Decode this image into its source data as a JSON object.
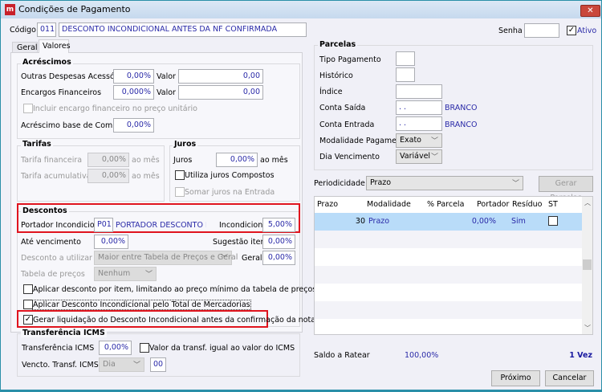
{
  "window": {
    "title": "Condições de Pagamento",
    "close_icon": "close-icon"
  },
  "header": {
    "codigo_label": "Código",
    "codigo": "011",
    "descricao": "DESCONTO INCONDICIONAL ANTES DA NF CONFIRMADA",
    "senha_label": "Senha",
    "senha": "",
    "ativo_label": "Ativo",
    "ativo_checked": true
  },
  "tabs": [
    {
      "label": "Geral",
      "active": false
    },
    {
      "label": "Valores",
      "active": true
    }
  ],
  "acrescimos": {
    "title": "Acréscimos",
    "outras_label": "Outras Despesas Acessórias",
    "outras_pct": "0,00%",
    "valor_label": "Valor",
    "outras_valor": "0,00",
    "encargos_label": "Encargos Financeiros",
    "encargos_pct": "0,000%",
    "encargos_valor": "0,00",
    "incluir_label": "Incluir encargo financeiro no preço unitário",
    "comissao_label": "Acréscimo base de Comissão",
    "comissao_pct": "0,00%"
  },
  "tarifas": {
    "title": "Tarifas",
    "financeira_label": "Tarifa financeira",
    "financeira": "0,00%",
    "acumulativa_label": "Tarifa acumulativa",
    "acumulativa": "0,00%",
    "ao_mes": "ao mês"
  },
  "juros": {
    "title": "Juros",
    "juros_label": "Juros",
    "juros": "0,00%",
    "ao_mes": "ao mês",
    "compostos_label": "Utiliza juros Compostos",
    "somar_label": "Somar juros na Entrada"
  },
  "descontos": {
    "title": "Descontos",
    "portador_label": "Portador Incondicional",
    "portador_code": "P01",
    "portador_name": "PORTADOR DESCONTO INCONDICIONAL",
    "incondicional_label": "Incondicional",
    "incondicional": "5,00%",
    "ate_label": "Até vencimento",
    "ate": "0,00%",
    "sugestao_label": "Sugestão itens",
    "sugestao": "0,00%",
    "utilizar_label": "Desconto a utilizar",
    "utilizar": "Maior entre Tabela de Preços e Geral",
    "geral_label": "Geral",
    "geral": "0,00%",
    "tabela_label": "Tabela de preços",
    "tabela": "Nenhum",
    "cb1": "Aplicar desconto por item, limitando ao preço mínimo da tabela de preços",
    "cb2": "Aplicar Desconto Incondicional pelo Total de Mercadorias",
    "cb3": "Gerar liquidação do Desconto Incondicional antes da confirmação da nota",
    "cb3_checked": true
  },
  "icms": {
    "title": "Transferência ICMS",
    "transf_label": "Transferência ICMS",
    "transf": "0,00%",
    "igual_label": "Valor da transf. igual ao valor do ICMS",
    "vencto_label": "Vencto. Transf. ICMS",
    "vencto": "Dia",
    "dia": "00"
  },
  "parcelas": {
    "title": "Parcelas",
    "tipo_label": "Tipo Pagamento",
    "historico_label": "Histórico",
    "indice_label": "Índice",
    "saida_label": "Conta Saída",
    "saida": " . .",
    "saida_name": "BRANCO",
    "entrada_label": "Conta Entrada",
    "entrada": " . .",
    "entrada_name": "BRANCO",
    "modalidade_label": "Modalidade Pagamento",
    "modalidade": "Exato",
    "dia_label": "Dia Vencimento",
    "dia": "Variável"
  },
  "periodicidade": {
    "label": "Periodicidade",
    "value": "Prazo",
    "gerar_label": "Gerar Parcelas"
  },
  "grid": {
    "columns": [
      "Prazo",
      "Modalidade",
      "% Parcela",
      "Portador",
      "Resíduo",
      "ST"
    ],
    "rows": [
      {
        "prazo": "30",
        "modalidade": "Prazo",
        "parcela": "0,00%",
        "portador": "",
        "residuo": "Sim",
        "st": false
      }
    ]
  },
  "footer": {
    "saldo_label": "Saldo a Ratear",
    "saldo": "100,00%",
    "vezes": "1 Vez",
    "proximo": "Próximo",
    "cancelar": "Cancelar"
  }
}
